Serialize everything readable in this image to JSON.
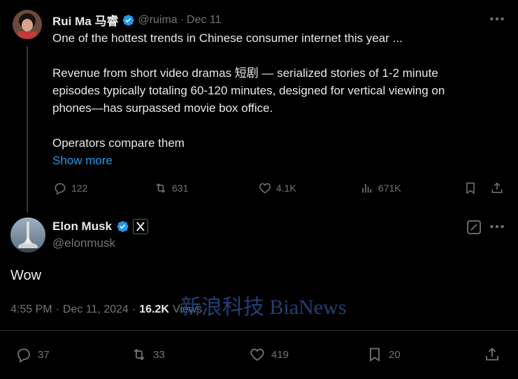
{
  "quoted_tweet": {
    "author_name": "Rui Ma 马睿",
    "handle": "@ruima",
    "separator": "·",
    "date": "Dec 11",
    "paragraph1": "One of the hottest trends in Chinese consumer internet this year ...",
    "paragraph2_line1": "Revenue from short video dramas 短剧 — serialized stories of 1-2 minute",
    "paragraph2_line2": "episodes typically totaling 60-120 minutes, designed for vertical viewing on",
    "paragraph2_line3": "phones—has surpassed movie box office.",
    "paragraph3": "Operators compare them",
    "show_more": "Show more",
    "replies": "122",
    "reposts": "631",
    "likes": "4.1K",
    "views": "671K"
  },
  "main_tweet": {
    "author_name": "Elon Musk",
    "handle": "@elonmusk",
    "text": "Wow",
    "time": "4:55 PM",
    "separator": "·",
    "date": "Dec 11, 2024",
    "view_count": "16.2K",
    "views_label": "Views",
    "replies": "37",
    "reposts": "33",
    "likes": "419",
    "bookmarks": "20"
  },
  "watermark": "新浪科技 BiaNews",
  "colors": {
    "background": "#000000",
    "text": "#e7e9ea",
    "muted": "#71767b",
    "link": "#1d9bf0",
    "verified": "#1d9bf0"
  }
}
